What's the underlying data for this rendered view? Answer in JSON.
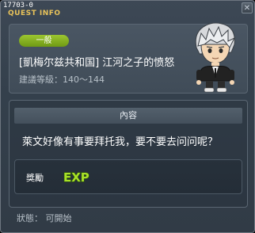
{
  "window": {
    "id_label": "17703-0",
    "title": "QUEST INFO",
    "close_icon": "close-icon"
  },
  "quest": {
    "category": "一般",
    "title": "[凱梅尔兹共和国] 江河之子的愤怒",
    "level_label": "建議等級：140～144",
    "npc_icon": "npc-portrait-white-haired-man"
  },
  "content": {
    "header": "內容",
    "description": "萊文好像有事要拜托我，要不要去问问呢？"
  },
  "reward": {
    "label": "獎勵",
    "item_icon": "exp-icon",
    "item_text": "EXP"
  },
  "status": {
    "text": "狀態： 可開始"
  },
  "colors": {
    "title_gold": "#e9c35a",
    "badge_green": "#8ab626",
    "exp_green": "#a8e028"
  }
}
